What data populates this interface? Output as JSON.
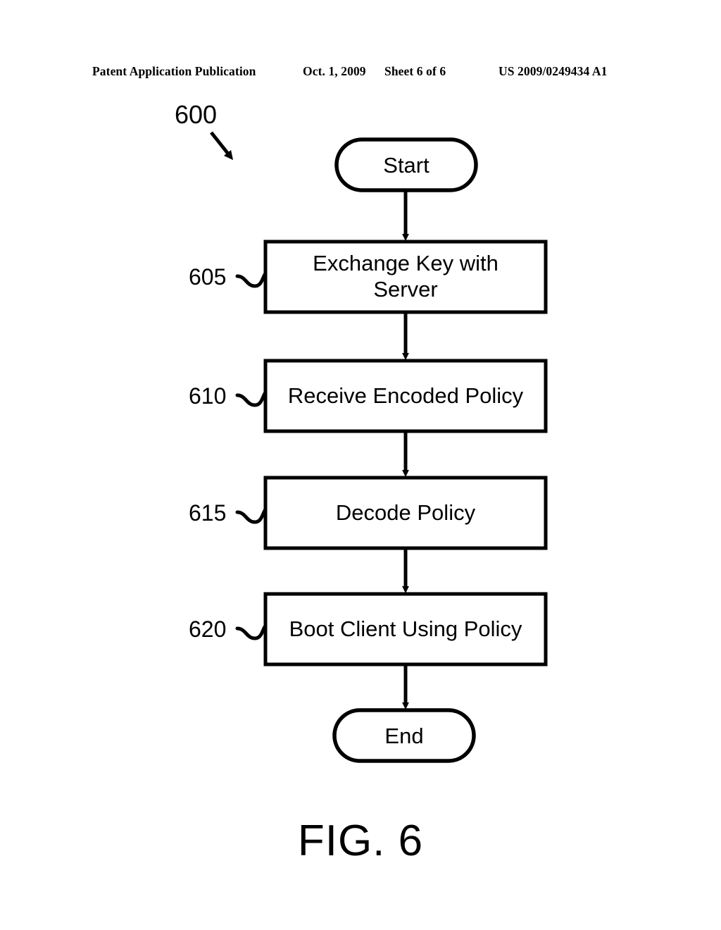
{
  "header": {
    "publication": "Patent Application Publication",
    "date": "Oct. 1, 2009",
    "sheet": "Sheet 6 of 6",
    "patent_number": "US 2009/0249434 A1"
  },
  "figure": {
    "caption": "FIG. 6",
    "flow_reference": "600",
    "nodes": [
      {
        "id": "start",
        "shape": "stadium",
        "label": "Start"
      },
      {
        "id": "step-605",
        "shape": "rectangle",
        "label": "Exchange Key with Server",
        "line1": "Exchange Key with",
        "line2": "Server",
        "ref": "605"
      },
      {
        "id": "step-610",
        "shape": "rectangle",
        "label": "Receive Encoded Policy",
        "ref": "610"
      },
      {
        "id": "step-615",
        "shape": "rectangle",
        "label": "Decode Policy",
        "ref": "615"
      },
      {
        "id": "step-620",
        "shape": "rectangle",
        "label": "Boot Client Using Policy",
        "ref": "620"
      },
      {
        "id": "end",
        "shape": "stadium",
        "label": "End"
      }
    ],
    "connectors": [
      {
        "from": "start",
        "to": "step-605",
        "style": "arrow-down"
      },
      {
        "from": "step-605",
        "to": "step-610",
        "style": "arrow-down"
      },
      {
        "from": "step-610",
        "to": "step-615",
        "style": "arrow-down"
      },
      {
        "from": "step-615",
        "to": "step-620",
        "style": "arrow-down"
      },
      {
        "from": "step-620",
        "to": "end",
        "style": "arrow-down"
      }
    ]
  },
  "colors": {
    "ink": "#000000",
    "paper": "#ffffff"
  }
}
